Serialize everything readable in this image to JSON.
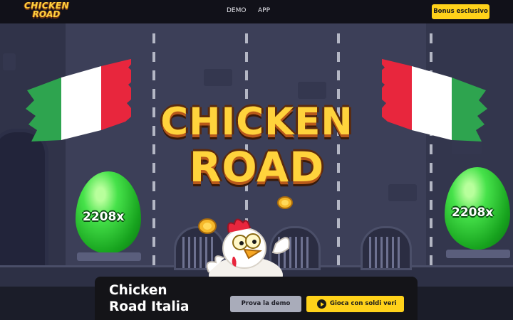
{
  "header": {
    "logo_line1": "CHICKEN",
    "logo_line2": "ROAD",
    "nav": [
      {
        "label": "DEMO"
      },
      {
        "label": "APP"
      }
    ],
    "bonus_button": "Bonus esclusivo"
  },
  "scene": {
    "title_line1": "CHICKEN",
    "title_line2": "ROAD",
    "left_egg_multiplier": "2208x",
    "right_egg_multiplier": "2208x",
    "flag_colors": [
      "#2ea44f",
      "#ffffff",
      "#e8263d"
    ]
  },
  "hero": {
    "title_line1": "Chicken",
    "title_line2": "Road Italia",
    "demo_button": "Prova la demo",
    "play_button": "Gioca con soldi veri"
  },
  "colors": {
    "accent_yellow": "#ffd21a",
    "topbar_bg": "#111119",
    "scene_bg": "#3c3f58",
    "egg_green": "#2fc93a"
  }
}
